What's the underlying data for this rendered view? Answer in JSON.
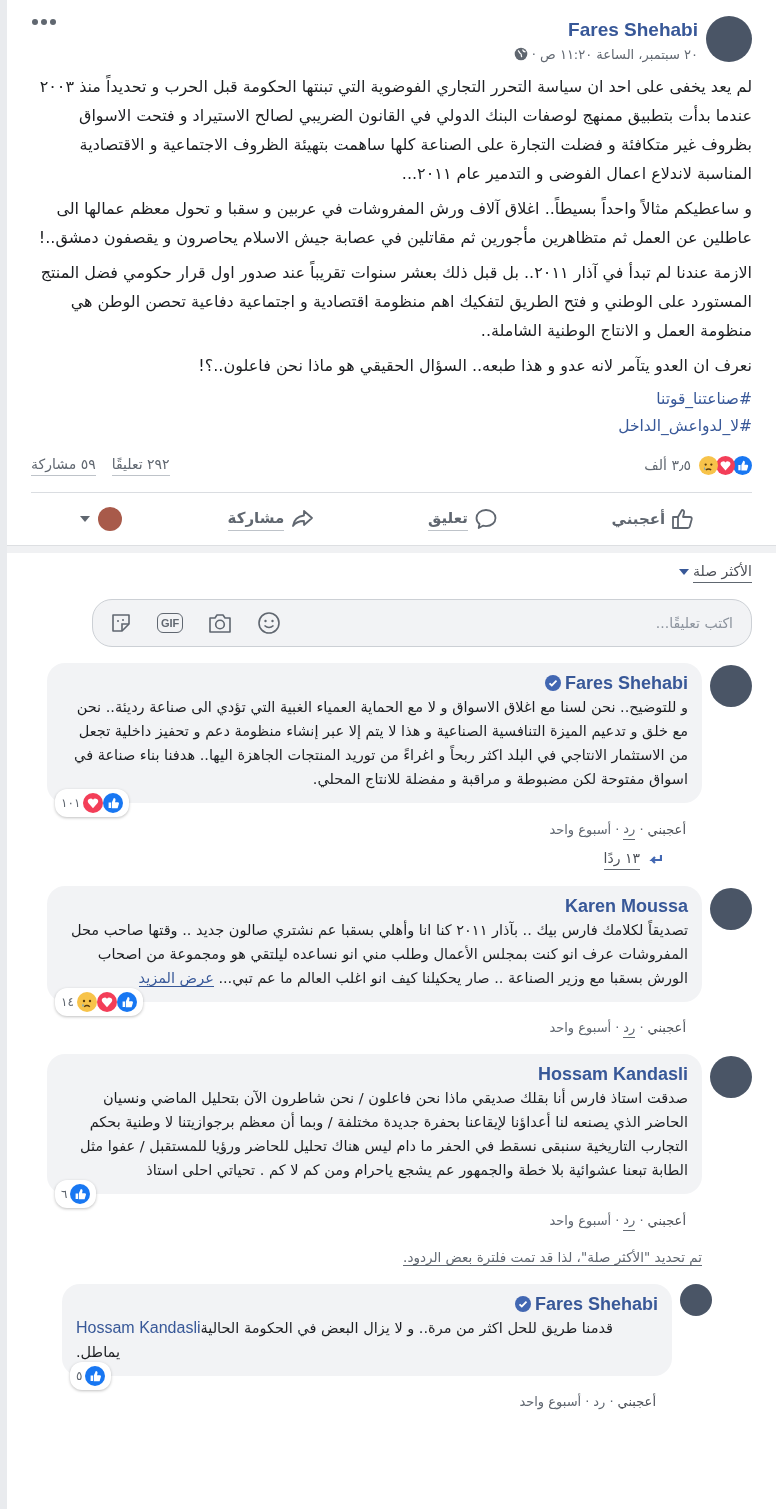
{
  "post": {
    "author": "Fares Shehabi",
    "timestamp": "٢٠ سبتمبر، الساعة ١١:٢٠ ص ·",
    "paragraphs": [
      "لم يعد يخفى على احد ان سياسة التحرر التجاري الفوضوية التي تبنتها الحكومة قبل الحرب و تحديداً منذ ٢٠٠٣ عندما بدأت بتطبيق ممنهج لوصفات البنك الدولي في القانون الضريبي لصالح الاستيراد و فتحت الاسواق بظروف غير متكافئة و فضلت التجارة على الصناعة كلها ساهمت بتهيئة الظروف الاجتماعية و الاقتصادية المناسبة لاندلاع اعمال الفوضى و التدمير عام ٢٠١١...",
      "و ساعطيكم مثالاً واحداً بسيطاً.. اغلاق آلاف ورش المفروشات في عربين و سقبا و تحول معظم عمالها الى عاطلين عن العمل ثم متظاهرين مأجورين ثم مقاتلين في عصابة جيش الاسلام يحاصرون و يقصفون دمشق..!",
      "الازمة عندنا لم تبدأ في آذار ٢٠١١.. بل قبل ذلك بعشر سنوات تقريباً عند صدور اول قرار حكومي فضل المنتج المستورد على الوطني و فتح الطريق لتفكيك اهم منظومة اقتصادية و اجتماعية دفاعية تحصن الوطن هي منظومة العمل و الانتاج الوطنية الشاملة..",
      "نعرف ان العدو يتآمر لانه عدو و هذا طبعه.. السؤال الحقيقي هو ماذا نحن فاعلون..؟!"
    ],
    "hashtags": [
      "#صناعتنا_قوتنا",
      "#لا_لدواعش_الداخل"
    ],
    "reactions": [
      {
        "kind": "like"
      },
      {
        "kind": "love"
      },
      {
        "kind": "sad"
      }
    ],
    "reactions_count": "٣٫٥ ألف",
    "comments_count": "٢٩٢ تعليقًا",
    "shares_count": "٥٩ مشاركة",
    "actions": [
      {
        "kind": "like",
        "label": "أعجبني"
      },
      {
        "kind": "comment",
        "label": "تعليق"
      },
      {
        "kind": "share",
        "label": "مشاركة"
      }
    ]
  },
  "comments_section": {
    "sort_label": "الأكثر صلة",
    "composer": {
      "placeholder": "اكتب تعليقًا...",
      "gif_label": "GIF"
    },
    "comments": [
      {
        "author": "Fares Shehabi",
        "verified": true,
        "text": "و للتوضيح.. نحن لسنا مع اغلاق الاسواق و لا مع الحماية العمياء الغبية التي تؤدي الى صناعة رديئة.. نحن مع خلق و تدعيم الميزة التنافسية الصناعية و هذا لا يتم إلا عبر إنشاء منظومة دعم و تحفيز داخلية تجعل من الاستثمار الانتاجي في البلد اكثر ربحاً و اغراءً من توريد المنتجات الجاهزة اليها.. هدفنا بناء صناعة في اسواق مفتوحة لكن مضبوطة و مراقبة و مفضلة للانتاج المحلي.",
        "reactions": [
          {
            "kind": "like"
          },
          {
            "kind": "love"
          }
        ],
        "reactions_count": "١٠١",
        "actions": [
          {
            "kind": "like",
            "label": "أعجبني"
          },
          {
            "kind": "separator",
            "label": "·"
          },
          {
            "kind": "reply",
            "label": "رد"
          },
          {
            "kind": "separator",
            "label": "·"
          },
          {
            "kind": "time",
            "label": "أسبوع واحد"
          }
        ],
        "replies_link": "١٣ ردًا"
      },
      {
        "author": "Karen Moussa",
        "verified": false,
        "text": "تصديقاً لكلامك فارس بيك .. بآذار ٢٠١١ كنا انا وأهلي بسقبا عم نشتري صالون جديد .. وقتها صاحب محل المفروشات عرف انو كنت بمجلس الأعمال وطلب مني انو نساعده ليلتقي هو ومجموعة من اصحاب الورش بسقبا مع وزير الصناعة .. صار يحكيلنا كيف انو اغلب العالم ما عم تبي...",
        "see_more": "عرض المزيد",
        "reactions": [
          {
            "kind": "like"
          },
          {
            "kind": "love"
          },
          {
            "kind": "sad"
          }
        ],
        "reactions_count": "١٤",
        "actions": [
          {
            "kind": "like",
            "label": "أعجبني"
          },
          {
            "kind": "separator",
            "label": "·"
          },
          {
            "kind": "reply",
            "label": "رد"
          },
          {
            "kind": "separator",
            "label": "·"
          },
          {
            "kind": "time",
            "label": "أسبوع واحد"
          }
        ]
      },
      {
        "author": "Hossam Kandasli",
        "verified": false,
        "text": "صدقت استاذ فارس أنا بقلك صديقي ماذا نحن فاعلون / نحن شاطرون الآن بتحليل الماضي ونسيان الحاضر الذي يصنعه لنا أعداؤنا لإيقاعنا بحفرة جديدة مختلفة / وبما أن معظم برجوازيتنا لا وطنية بحكم التجارب التاريخية سنبقى نسقط في الحفر ما دام ليس هناك تحليل للحاضر ورؤيا للمستقبل / عفوا مثل الطابة تبعنا عشوائية بلا خطة والجمهور عم يشجع ياحرام ومن كم لا كم . تحياتي احلى استاذ",
        "reactions": [
          {
            "kind": "like"
          }
        ],
        "reactions_count": "٦",
        "actions": [
          {
            "kind": "like",
            "label": "أعجبني"
          },
          {
            "kind": "separator",
            "label": "·"
          },
          {
            "kind": "reply",
            "label": "رد"
          },
          {
            "kind": "separator",
            "label": "·"
          },
          {
            "kind": "time",
            "label": "أسبوع واحد"
          }
        ],
        "filter_notice": "تم تحديد \"الأكثر صلة\"، لذا قد تمت فلترة بعض الردود.",
        "replies": [
          {
            "author": "Fares Shehabi",
            "verified": true,
            "mention": "Hossam Kandasli",
            "text": "قدمنا طريق للحل اكثر من مرة.. و لا يزال البعض في الحكومة الحالية يماطل.",
            "reactions": [
              {
                "kind": "like"
              }
            ],
            "reactions_count": "٥",
            "actions": [
              {
                "kind": "like",
                "label": "أعجبني"
              },
              {
                "kind": "separator",
                "label": "·"
              },
              {
                "kind": "reply",
                "label": "رد"
              },
              {
                "kind": "separator",
                "label": "·"
              },
              {
                "kind": "time",
                "label": "أسبوع واحد"
              }
            ]
          }
        ]
      }
    ]
  }
}
